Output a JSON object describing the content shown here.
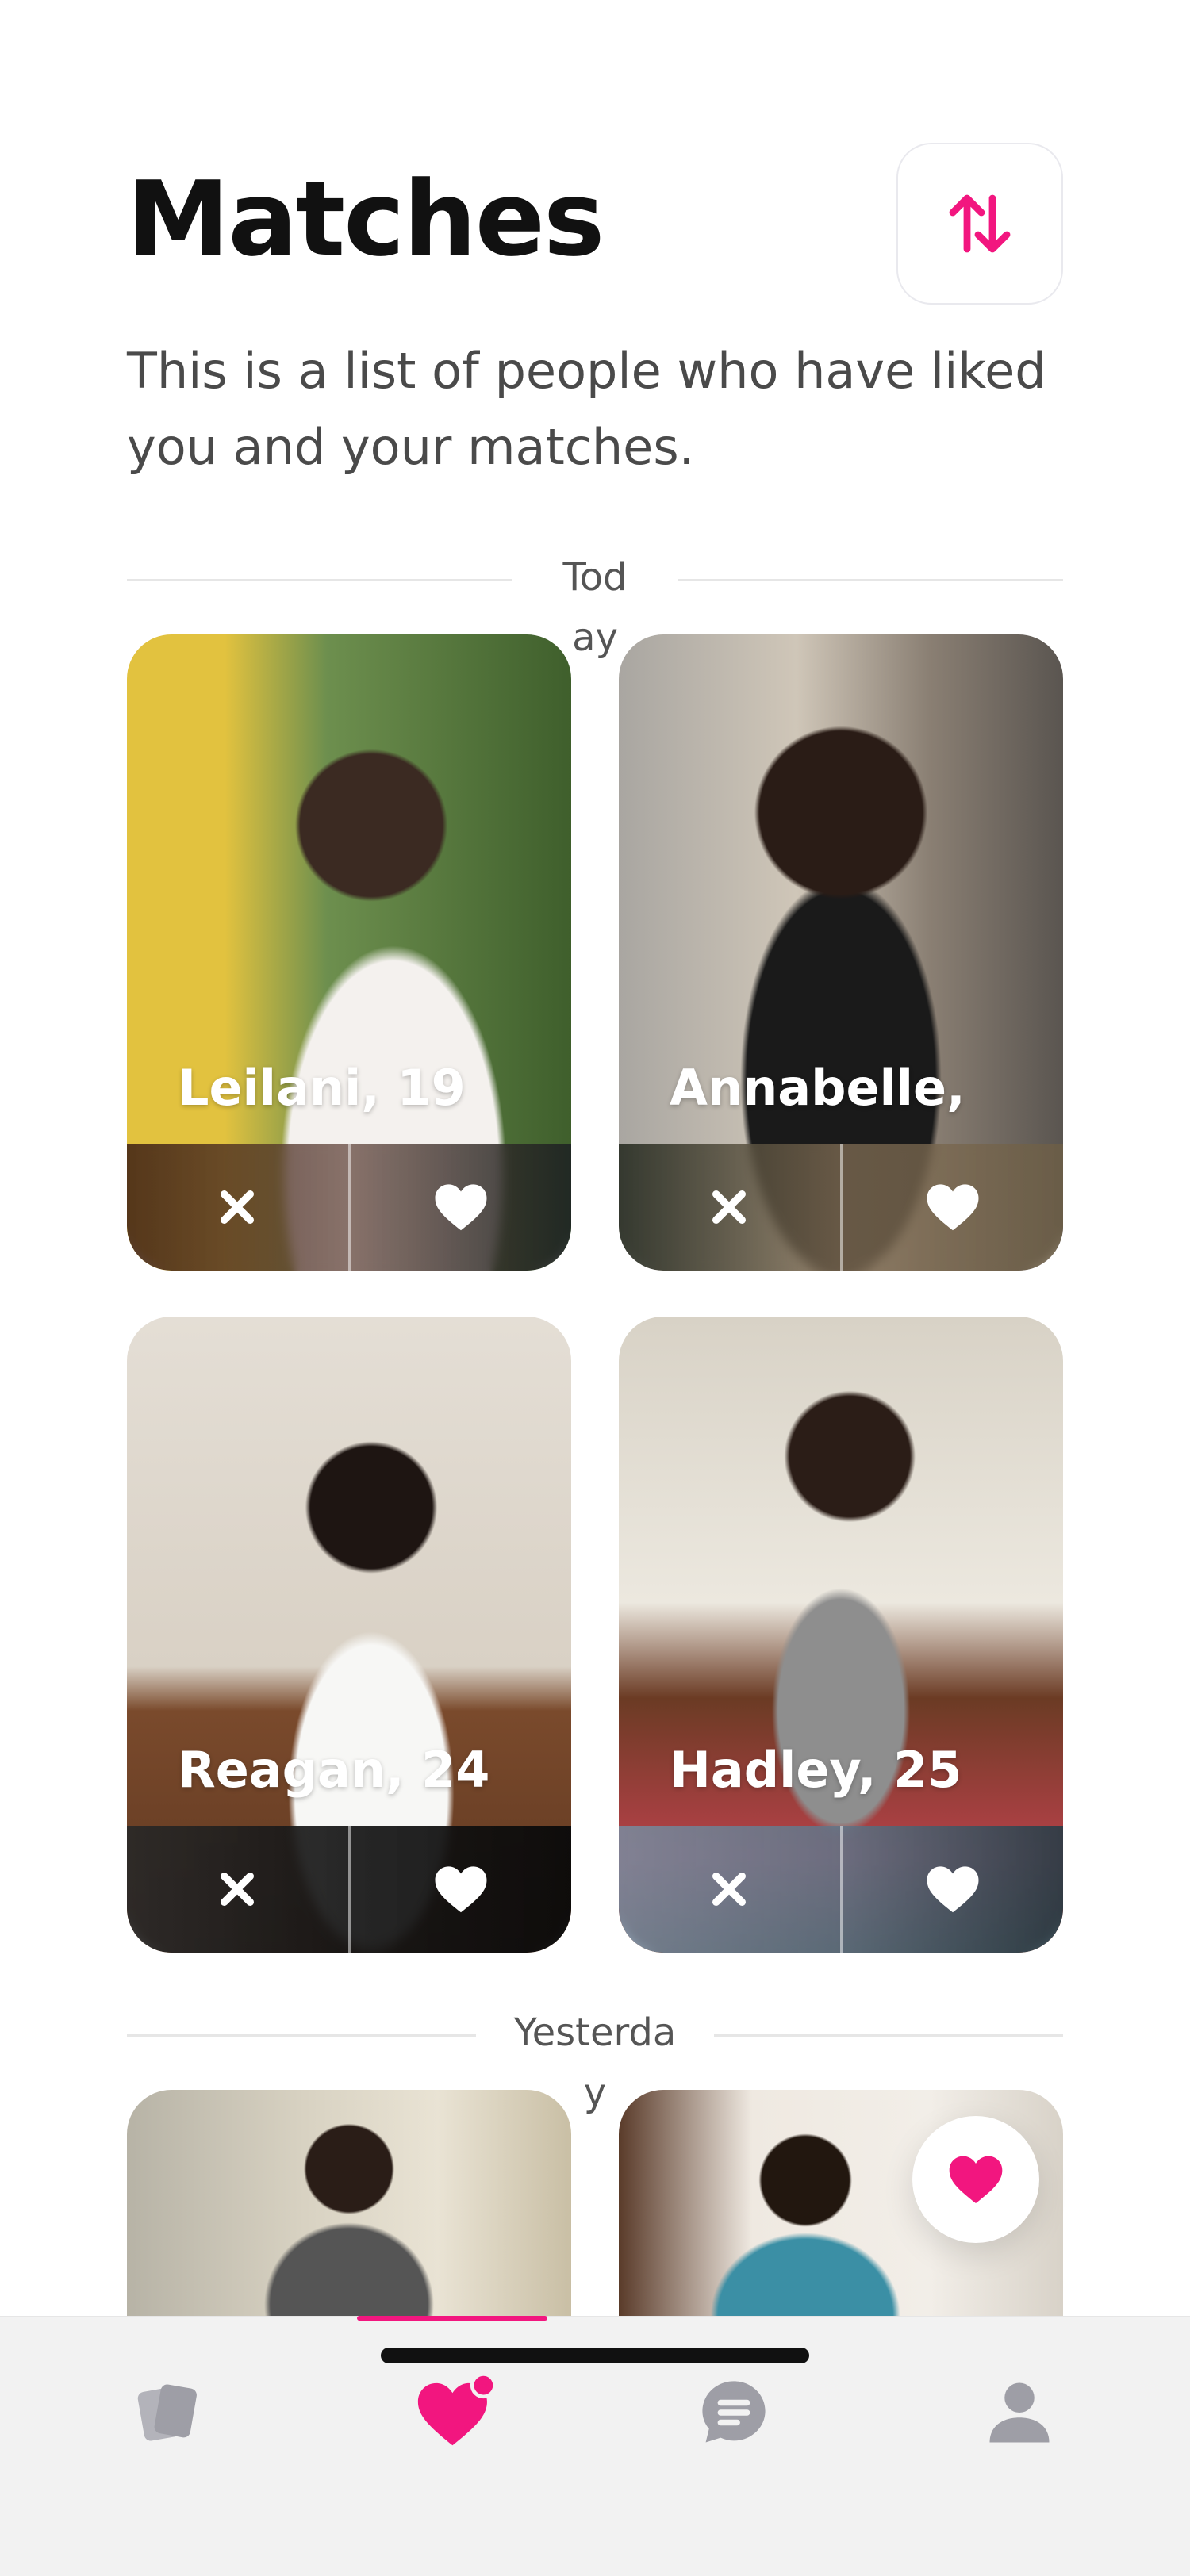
{
  "header": {
    "title": "Matches",
    "subtitle": "This is a list of people who have liked you and your matches."
  },
  "sections": [
    {
      "label": "Today"
    },
    {
      "label": "Yesterday"
    }
  ],
  "cards": [
    {
      "name": "Leilani, 19"
    },
    {
      "name": "Annabelle,"
    },
    {
      "name": "Reagan, 24"
    },
    {
      "name": "Hadley, 25"
    }
  ],
  "icons": {
    "sort": "sort-arrows-icon",
    "dislike": "close-icon",
    "like": "heart-icon",
    "fab": "heart-icon",
    "tabs": [
      "cards-icon",
      "matches-heart-icon",
      "messages-icon",
      "profile-icon"
    ]
  },
  "colors": {
    "accent": "#f2167f",
    "tab_inactive": "#9e9ea6",
    "title": "#111111",
    "subtitle": "#4a4a4a"
  },
  "tabs": [
    {
      "name": "discover",
      "active": false
    },
    {
      "name": "matches",
      "active": true
    },
    {
      "name": "messages",
      "active": false
    },
    {
      "name": "profile",
      "active": false
    }
  ]
}
